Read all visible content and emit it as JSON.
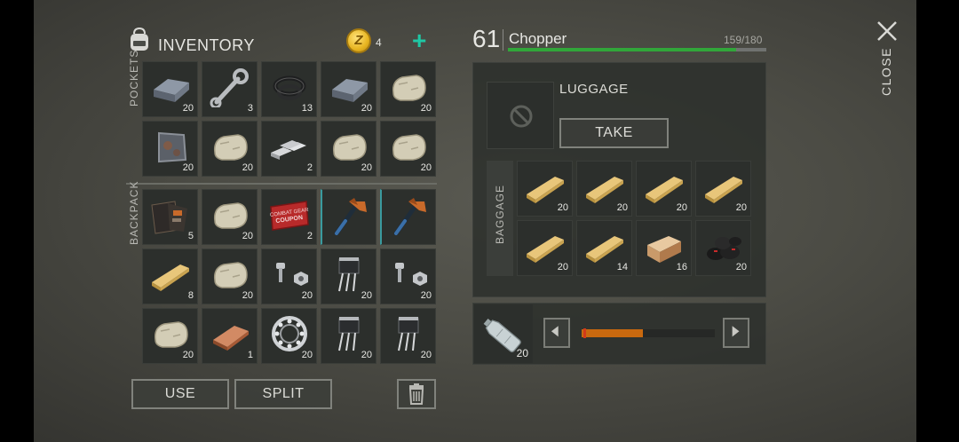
{
  "inventory": {
    "title": "INVENTORY",
    "coins": "4",
    "plus": "+",
    "coin_symbol": "Z",
    "pockets_label": "POCKETS",
    "backpack_label": "BACKPACK",
    "pockets": [
      {
        "icon": "iron-bar-icon",
        "qty": "20"
      },
      {
        "icon": "wrench-icon",
        "qty": "3"
      },
      {
        "icon": "rubber-rings-icon",
        "qty": "13"
      },
      {
        "icon": "iron-bar-icon",
        "qty": "20"
      },
      {
        "icon": "stone-icon",
        "qty": "20"
      },
      {
        "icon": "metal-plate-icon",
        "qty": "20"
      },
      {
        "icon": "stone-icon",
        "qty": "20"
      },
      {
        "icon": "silver-bars-icon",
        "qty": "2"
      },
      {
        "icon": "stone-icon",
        "qty": "20"
      },
      {
        "icon": "stone-icon",
        "qty": "20"
      }
    ],
    "backpack": [
      {
        "icon": "wallet-icon",
        "qty": "5"
      },
      {
        "icon": "stone-icon",
        "qty": "20"
      },
      {
        "icon": "combat-gear-coupon-icon",
        "qty": "2",
        "text": "COMBAT GEAR COUPON"
      },
      {
        "icon": "hatchet-icon",
        "qty": ""
      },
      {
        "icon": "hatchet-icon",
        "qty": ""
      },
      {
        "icon": "wood-plank-icon",
        "qty": "8"
      },
      {
        "icon": "stone-icon",
        "qty": "20"
      },
      {
        "icon": "bolt-nut-icon",
        "qty": "20"
      },
      {
        "icon": "transistor-icon",
        "qty": "20"
      },
      {
        "icon": "bolt-nut-icon",
        "qty": "20"
      },
      {
        "icon": "stone-icon",
        "qty": "20"
      },
      {
        "icon": "copper-ingot-icon",
        "qty": "1"
      },
      {
        "icon": "bearing-icon",
        "qty": "20"
      },
      {
        "icon": "transistor-icon",
        "qty": "20"
      },
      {
        "icon": "transistor-icon",
        "qty": "20"
      }
    ],
    "buttons": {
      "use": "USE",
      "split": "SPLIT"
    }
  },
  "vehicle": {
    "level": "61",
    "name": "Chopper",
    "capacity": "159/180",
    "capacity_fraction": 0.883,
    "luggage_label": "LUGGAGE",
    "take_label": "TAKE",
    "baggage_label": "BAGGAGE",
    "baggage": [
      {
        "icon": "wood-plank-icon",
        "qty": "20"
      },
      {
        "icon": "wood-plank-icon",
        "qty": "20"
      },
      {
        "icon": "wood-plank-icon",
        "qty": "20"
      },
      {
        "icon": "wood-plank-icon",
        "qty": "20"
      },
      {
        "icon": "wood-plank-icon",
        "qty": "20"
      },
      {
        "icon": "wood-plank-icon",
        "qty": "14"
      },
      {
        "icon": "wood-block-icon",
        "qty": "16"
      },
      {
        "icon": "coal-icon",
        "qty": "20"
      }
    ]
  },
  "transfer": {
    "item_icon": "plastic-bottle-icon",
    "qty": "20",
    "slider_fraction": 0.46
  },
  "close_label": "CLOSE",
  "colors": {
    "accent_teal": "#1fc7a5",
    "capacity_green": "#31a63a",
    "slider_orange": "#c9690f"
  }
}
